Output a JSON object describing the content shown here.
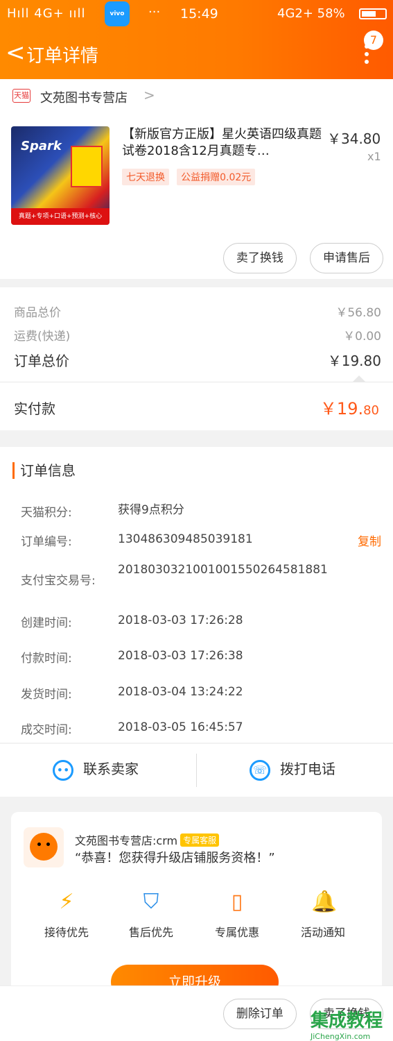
{
  "status": {
    "signal": "Hıll 4G+ ııll",
    "vivo": "vivo",
    "dots": "···",
    "time": "15:49",
    "right": "4G2+ 58%"
  },
  "nav": {
    "back": "<",
    "title": "订单详情",
    "badge": "7"
  },
  "store": {
    "icon_text": "天猫",
    "name": "文苑图书专营店",
    "arrow": ">"
  },
  "product": {
    "cover_text": "Spark",
    "cover_bottom": "真题+专项+口语+预测+核心",
    "title": "【新版官方正版】星火英语四级真题试卷2018含12月真题专…",
    "price": "￥34.80",
    "qty": "x1",
    "tags": [
      "七天退换",
      "公益捐赠0.02元"
    ],
    "buttons": [
      "卖了换钱",
      "申请售后"
    ]
  },
  "costs": {
    "goods_label": "商品总价",
    "goods_value": "￥56.80",
    "ship_label": "运费(快递)",
    "ship_value": "￥0.00",
    "order_label": "订单总价",
    "order_value": "￥19.80",
    "paid_label": "实付款",
    "paid_int": "￥19.",
    "paid_dec": "80"
  },
  "order_info": {
    "header": "订单信息",
    "rows": [
      {
        "k": "天猫积分:",
        "v": "获得9点积分"
      },
      {
        "k": "订单编号:",
        "v": "130486309485039181",
        "action": "复制"
      },
      {
        "k": "支付宝交易号:",
        "v": "2018030321001001550264581881"
      },
      {
        "k": "创建时间:",
        "v": "2018-03-03 17:26:28"
      },
      {
        "k": "付款时间:",
        "v": "2018-03-03 17:26:38"
      },
      {
        "k": "发货时间:",
        "v": "2018-03-04 13:24:22"
      },
      {
        "k": "成交时间:",
        "v": "2018-03-05 16:45:57"
      }
    ]
  },
  "contact": {
    "seller": "联系卖家",
    "phone": "拨打电话"
  },
  "promo": {
    "name": "文苑图书专营店:crm",
    "tag": "专属客服",
    "message": "“恭喜！您获得升级店铺服务资格！”",
    "features": [
      {
        "label": "接待优先",
        "icon": "lightning-icon"
      },
      {
        "label": "售后优先",
        "icon": "shield-icon"
      },
      {
        "label": "专属优惠",
        "icon": "ticket-icon"
      },
      {
        "label": "活动通知",
        "icon": "bell-icon"
      }
    ],
    "button": "立即升级"
  },
  "footer": {
    "buttons": [
      "删除订单",
      "卖了换钱"
    ]
  },
  "watermark": {
    "main": "集成教程",
    "sub": "JiChengXin.com"
  },
  "colors": {
    "accent": "#ff6a00",
    "blue": "#1b9bff",
    "price_red": "#ff5a1a"
  }
}
